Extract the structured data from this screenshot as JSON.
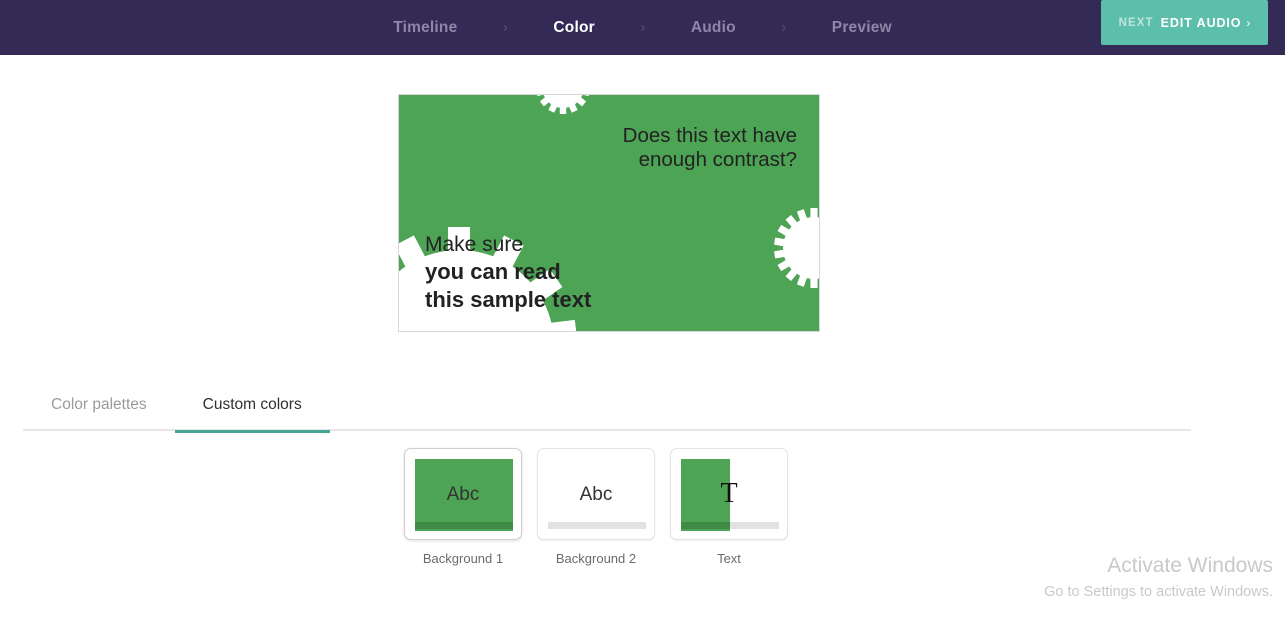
{
  "header": {
    "steps": [
      {
        "label": "Timeline",
        "active": false
      },
      {
        "label": "Color",
        "active": true
      },
      {
        "label": "Audio",
        "active": false
      },
      {
        "label": "Preview",
        "active": false
      }
    ],
    "separator": "›",
    "next_button": {
      "prefix": "NEXT",
      "label": "EDIT AUDIO",
      "chevron": "›"
    },
    "background_color": "#332a56",
    "accent_color": "#5cbfab"
  },
  "preview": {
    "heading_text_line1": "Does this text have",
    "heading_text_line2": "enough contrast?",
    "body_text_line1": "Make sure",
    "body_text_line2": "you can read",
    "body_text_line3": "this sample text",
    "background_color": "#4ea455",
    "shape_color": "#ffffff",
    "text_color": "#222222",
    "frame_border_color": "#d7d7d7"
  },
  "tabs": [
    {
      "label": "Color palettes",
      "active": false
    },
    {
      "label": "Custom colors",
      "active": true
    }
  ],
  "tab_underline_color": "#45a696",
  "swatches": [
    {
      "label": "Background 1",
      "glyph": "Abc",
      "glyph_style": "sans",
      "selected": true,
      "fill_color": "#4ea455",
      "fill_mode": "full",
      "underbar_left_color": "#3f8a46",
      "underbar_right_color": "#3f8a46",
      "underbar_split": 100
    },
    {
      "label": "Background 2",
      "glyph": "Abc",
      "glyph_style": "sans",
      "selected": false,
      "fill_color": "#ffffff",
      "fill_mode": "full",
      "underbar_left_color": "#e2e2e2",
      "underbar_right_color": "#e2e2e2",
      "underbar_split": 100
    },
    {
      "label": "Text",
      "glyph": "T",
      "glyph_style": "serif",
      "selected": false,
      "fill_color": "#4ea455",
      "fill_mode": "half",
      "underbar_left_color": "#3f8a46",
      "underbar_right_color": "#e2e2e2",
      "underbar_split": 50
    }
  ],
  "watermark": {
    "title": "Activate Windows",
    "subtitle": "Go to Settings to activate Windows."
  }
}
